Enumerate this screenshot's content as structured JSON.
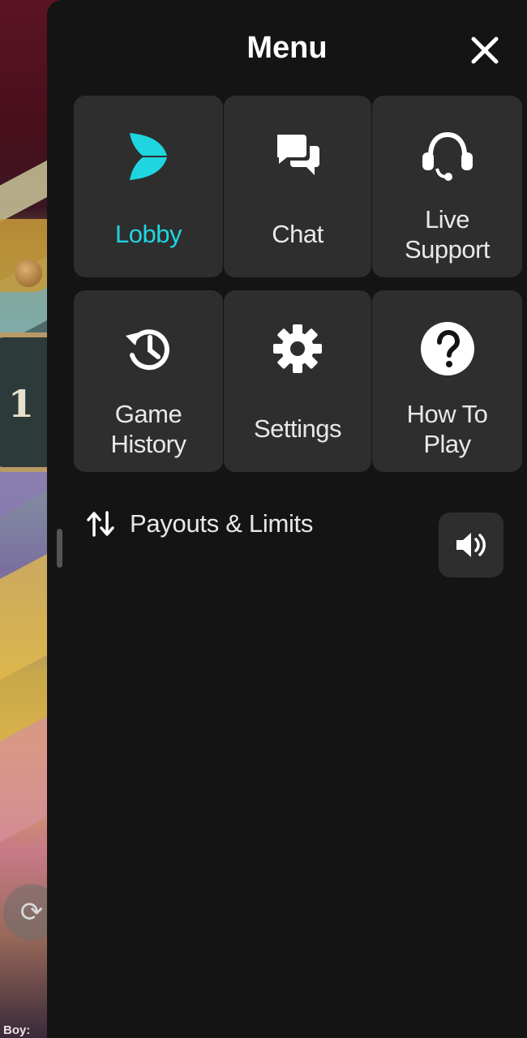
{
  "menu": {
    "title": "Menu",
    "tiles": [
      {
        "label": "Lobby",
        "icon": "lobby-logo-icon",
        "active": true
      },
      {
        "label": "Chat",
        "icon": "chat-bubbles-icon"
      },
      {
        "label": "Live\nSupport",
        "icon": "headset-icon"
      },
      {
        "label": "Game\nHistory",
        "icon": "history-icon"
      },
      {
        "label": "Settings",
        "icon": "gear-icon"
      },
      {
        "label": "How To\nPlay",
        "icon": "question-icon"
      }
    ],
    "payouts_label": "Payouts & Limits",
    "payouts_icon": "up-down-arrows-icon",
    "sound_icon": "speaker-icon"
  },
  "background": {
    "tile_glyph": "1",
    "caption": "Boy:"
  },
  "colors": {
    "panel": "#141414",
    "tile": "#2e2e2e",
    "accent": "#1fd6e0",
    "text": "#e8e8e8"
  }
}
